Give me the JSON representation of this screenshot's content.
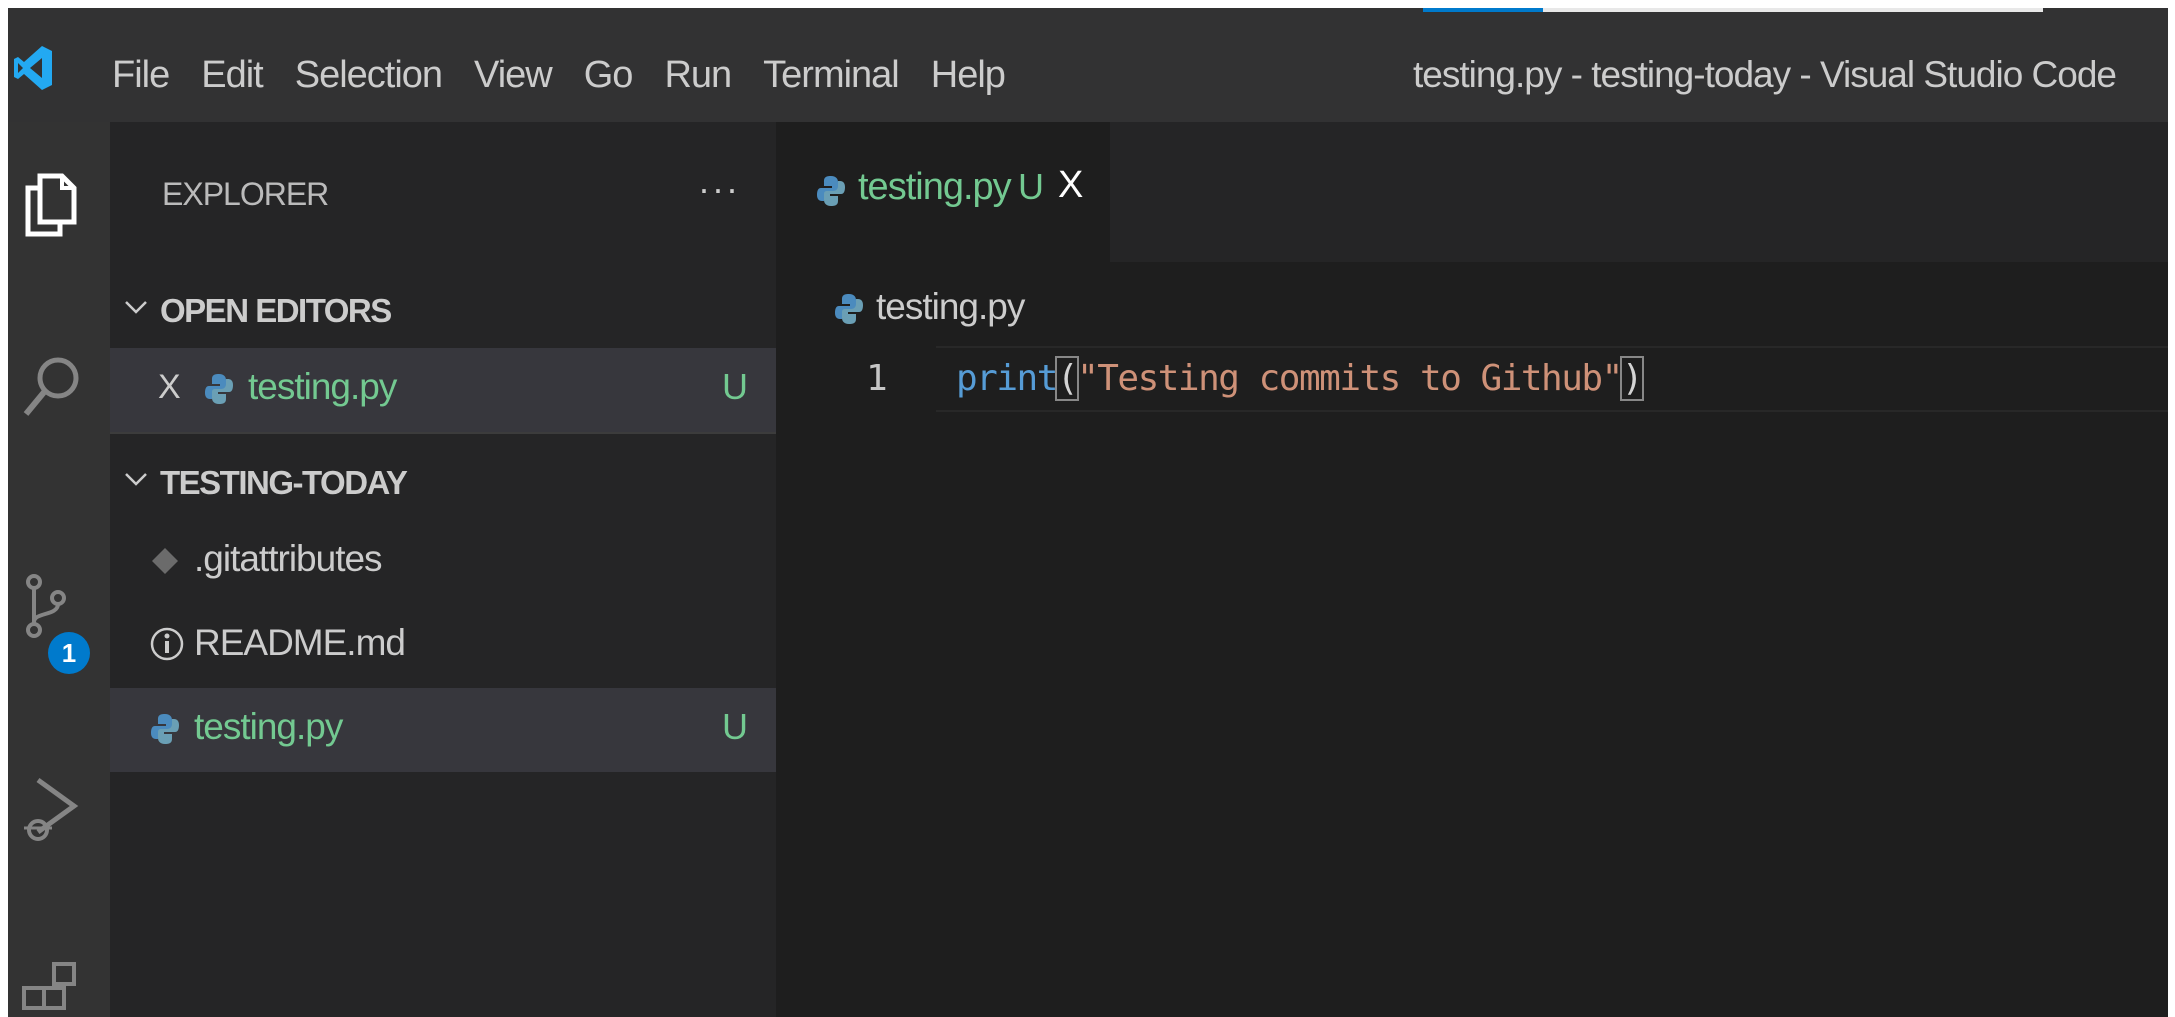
{
  "window": {
    "title": "testing.py - testing-today - Visual Studio Code"
  },
  "menu": [
    "File",
    "Edit",
    "Selection",
    "View",
    "Go",
    "Run",
    "Terminal",
    "Help"
  ],
  "activity_bar": {
    "items": [
      "explorer-icon",
      "search-icon",
      "source-control-icon",
      "run-debug-icon",
      "extensions-icon"
    ],
    "source_control_badge": "1"
  },
  "sidebar": {
    "title": "EXPLORER",
    "more": "···",
    "open_editors": {
      "label": "OPEN EDITORS",
      "items": [
        {
          "close": "X",
          "name": "testing.py",
          "status": "U"
        }
      ]
    },
    "folder": {
      "label": "TESTING-TODAY",
      "items": [
        {
          "name": ".gitattributes",
          "icon": "git-diamond-icon",
          "status": ""
        },
        {
          "name": "README.md",
          "icon": "info-icon",
          "status": ""
        },
        {
          "name": "testing.py",
          "icon": "python-icon",
          "status": "U"
        }
      ]
    }
  },
  "editor": {
    "tab": {
      "name": "testing.py",
      "status": "U",
      "close": "X"
    },
    "breadcrumb": "testing.py",
    "line_number": "1",
    "code": {
      "fn": "print",
      "open_paren": "(",
      "string": "\"Testing commits to Github\"",
      "close_paren": ")"
    }
  },
  "colors": {
    "accent": "#007acc",
    "untracked": "#73c991",
    "background": "#1e1e1e"
  }
}
